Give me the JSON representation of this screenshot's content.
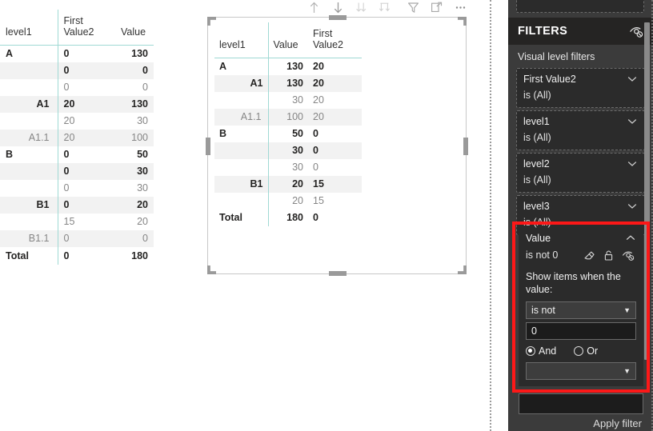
{
  "left_matrix": {
    "name": "left-matrix-visual",
    "columns": [
      "level1",
      "First Value2",
      "Value"
    ],
    "rows": [
      {
        "level1": "A",
        "first_value2": "0",
        "value": "130",
        "style": "bold",
        "indent": 0,
        "alt": false
      },
      {
        "level1": "",
        "first_value2": "0",
        "value": "0",
        "style": "bold",
        "indent": 1,
        "alt": true
      },
      {
        "level1": "",
        "first_value2": "0",
        "value": "0",
        "style": "dim",
        "indent": 2,
        "alt": false
      },
      {
        "level1": "A1",
        "first_value2": "20",
        "value": "130",
        "style": "bold",
        "indent": 1,
        "alt": true
      },
      {
        "level1": "",
        "first_value2": "20",
        "value": "30",
        "style": "dim",
        "indent": 2,
        "alt": false
      },
      {
        "level1": "A1.1",
        "first_value2": "20",
        "value": "100",
        "style": "dim",
        "indent": 2,
        "alt": true
      },
      {
        "level1": "B",
        "first_value2": "0",
        "value": "50",
        "style": "bold",
        "indent": 0,
        "alt": false
      },
      {
        "level1": "",
        "first_value2": "0",
        "value": "30",
        "style": "bold",
        "indent": 1,
        "alt": true
      },
      {
        "level1": "",
        "first_value2": "0",
        "value": "30",
        "style": "dim",
        "indent": 2,
        "alt": false
      },
      {
        "level1": "B1",
        "first_value2": "0",
        "value": "20",
        "style": "bold",
        "indent": 1,
        "alt": true
      },
      {
        "level1": "",
        "first_value2": "15",
        "value": "20",
        "style": "dim",
        "indent": 2,
        "alt": false
      },
      {
        "level1": "B1.1",
        "first_value2": "0",
        "value": "0",
        "style": "dim",
        "indent": 2,
        "alt": true
      },
      {
        "level1": "Total",
        "first_value2": "0",
        "value": "180",
        "style": "total",
        "indent": 0,
        "alt": false
      }
    ]
  },
  "center_visual": {
    "name": "center-matrix-visual",
    "selected": true,
    "toolbar": [
      {
        "name": "drill-up-icon",
        "label": "Drill up",
        "enabled": true
      },
      {
        "name": "drill-down-icon",
        "label": "Click to turn on drill down",
        "enabled": true
      },
      {
        "name": "go-to-next-level-icon",
        "label": "Go to the next level in the hierarchy",
        "enabled": false
      },
      {
        "name": "expand-all-down-icon",
        "label": "Expand all down one level in the hierarchy",
        "enabled": false
      },
      {
        "name": "filter-icon",
        "label": "Filters and slicers affecting this visual",
        "enabled": true
      },
      {
        "name": "focus-mode-icon",
        "label": "Focus mode",
        "enabled": true
      },
      {
        "name": "more-options-icon",
        "label": "More options",
        "enabled": true
      }
    ],
    "columns": [
      "level1",
      "Value",
      "First Value2"
    ],
    "rows": [
      {
        "level1": "A",
        "value": "130",
        "first_value2": "20",
        "style": "bold",
        "indent": 0,
        "alt": false
      },
      {
        "level1": "A1",
        "value": "130",
        "first_value2": "20",
        "style": "bold",
        "indent": 1,
        "alt": true
      },
      {
        "level1": "",
        "value": "30",
        "first_value2": "20",
        "style": "dim",
        "indent": 2,
        "alt": false
      },
      {
        "level1": "A1.1",
        "value": "100",
        "first_value2": "20",
        "style": "dim",
        "indent": 2,
        "alt": true
      },
      {
        "level1": "B",
        "value": "50",
        "first_value2": "0",
        "style": "bold",
        "indent": 0,
        "alt": false
      },
      {
        "level1": "",
        "value": "30",
        "first_value2": "0",
        "style": "bold",
        "indent": 1,
        "alt": true
      },
      {
        "level1": "",
        "value": "30",
        "first_value2": "0",
        "style": "dim",
        "indent": 2,
        "alt": false
      },
      {
        "level1": "B1",
        "value": "20",
        "first_value2": "15",
        "style": "bold",
        "indent": 1,
        "alt": true
      },
      {
        "level1": "",
        "value": "20",
        "first_value2": "15",
        "style": "dim",
        "indent": 2,
        "alt": false
      },
      {
        "level1": "Total",
        "value": "180",
        "first_value2": "0",
        "style": "total",
        "indent": 0,
        "alt": false
      }
    ]
  },
  "filters_pane": {
    "title": "FILTERS",
    "hide_icon": "hide-filter-pane-icon",
    "section_label": "Visual level filters",
    "cards": [
      {
        "field": "First Value2",
        "state": "is (All)",
        "collapsed": true
      },
      {
        "field": "level1",
        "state": "is (All)",
        "collapsed": true
      },
      {
        "field": "level2",
        "state": "is (All)",
        "collapsed": true
      },
      {
        "field": "level3",
        "state": "is (All)",
        "collapsed": true
      }
    ],
    "active_card": {
      "field": "Value",
      "state": "is not 0",
      "collapsed": false,
      "highlighted": true,
      "highlight_color": "#fc1818",
      "icons": [
        {
          "name": "clear-filter-icon",
          "label": "Clear filter"
        },
        {
          "name": "lock-filter-icon",
          "label": "Lock filter"
        },
        {
          "name": "hide-filter-icon",
          "label": "Hide filter"
        }
      ],
      "prompt": "Show items when the value:",
      "condition_1": "is not",
      "value_1": "0",
      "conjunction": {
        "selected": "And",
        "options": [
          "And",
          "Or"
        ]
      },
      "condition_2": "",
      "value_2": ""
    },
    "apply_label": "Apply filter"
  },
  "colors": {
    "pane_bg": "#3b3b3b",
    "pane_header_bg": "#252423",
    "card_bg": "#2b2b2b",
    "matrix_accent": "#9fd9d4",
    "alt_row": "#f2f2f2",
    "highlight": "#fc1818"
  }
}
